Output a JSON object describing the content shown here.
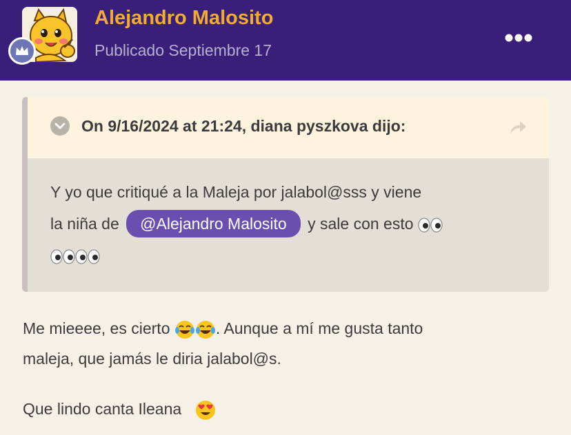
{
  "post": {
    "author": "Alejandro Malosito",
    "published": "Publicado Septiembre 17"
  },
  "quote": {
    "citation": "On 9/16/2024 at 21:24, diana pyszkova dijo:",
    "line1": "Y yo que critiqué a la Maleja por jalabol@sss y viene",
    "line2_prefix": "la niña de",
    "mention": "@Alejandro Malosito",
    "line2_suffix": "y sale con esto"
  },
  "body": {
    "paragraph1_part1": "Me mieeee, es cierto",
    "paragraph1_part2": ". Aunque a mí me gusta tanto",
    "paragraph1_line2": "maleja, que jamás le diria jalabol@s.",
    "paragraph2": "Que lindo canta Ileana"
  },
  "icons": {
    "more": "more-dots-icon",
    "toggle": "chevron-down-icon",
    "share": "share-arrow-icon",
    "badge": "crown-icon",
    "eyes": "eyes-emoji",
    "laugh": "tears-of-joy-emoji",
    "heart_eyes": "heart-eyes-emoji"
  },
  "colors": {
    "header": "#3a1f7a",
    "author": "#f2ad2f",
    "mention": "#6b4fb0",
    "background": "#f6f1e7"
  }
}
